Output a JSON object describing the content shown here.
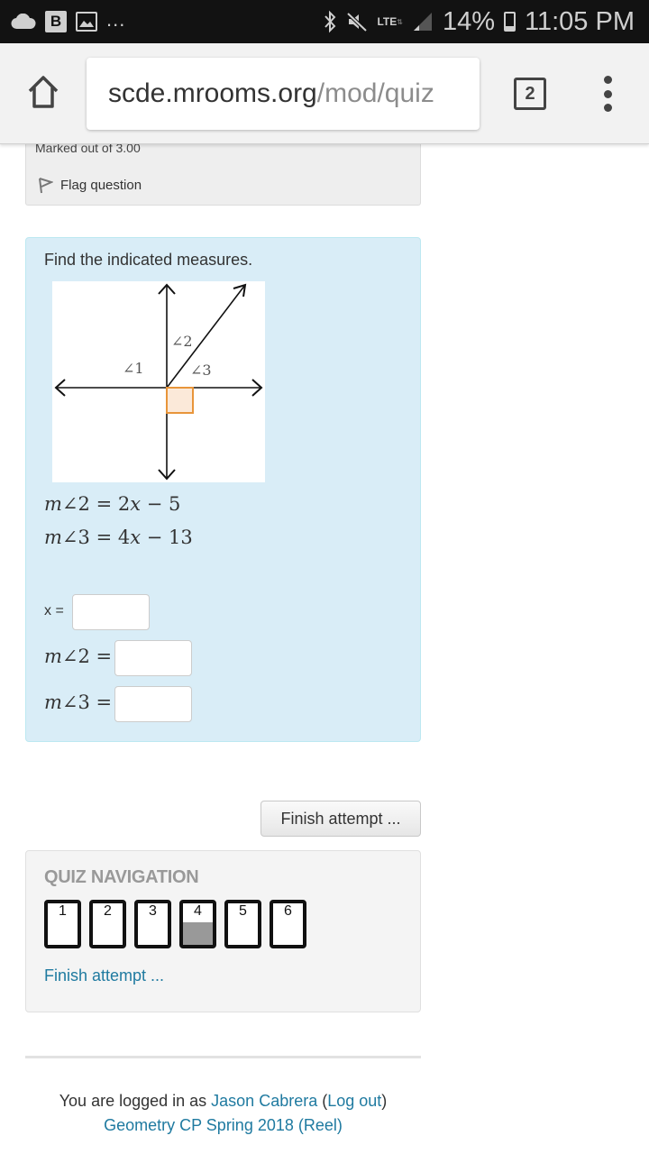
{
  "status_bar": {
    "left_icons": [
      "cloud-icon",
      "b-app-icon",
      "image-icon",
      "more-notifications-icon"
    ],
    "more_text": "...",
    "network_type": "LTE",
    "battery_percent": "14%",
    "time": "11:05 PM"
  },
  "browser": {
    "url_host": "scde.mrooms.org",
    "url_path": "/mod/quiz",
    "tab_count": "2"
  },
  "question_info": {
    "marked_out_of": "Marked out of 3.00",
    "flag_label": "Flag question"
  },
  "question": {
    "prompt": "Find the indicated measures.",
    "figure_labels": {
      "angle1": "∠1",
      "angle2": "∠2",
      "angle3": "∠3"
    },
    "equations": [
      {
        "lhs_m": "m",
        "lhs_angle": "∠2",
        "rhs": "= 2",
        "var": "x",
        "tail": " − 5"
      },
      {
        "lhs_m": "m",
        "lhs_angle": "∠3",
        "rhs": "= 4",
        "var": "x",
        "tail": " − 13"
      }
    ],
    "answers": [
      {
        "label": "x =",
        "value": ""
      },
      {
        "label_m": "m",
        "label_angle": "∠2 =",
        "value": ""
      },
      {
        "label_m": "m",
        "label_angle": "∠3 =",
        "value": ""
      }
    ]
  },
  "finish_button_label": "Finish attempt ...",
  "quiz_navigation": {
    "title": "QUIZ NAVIGATION",
    "questions": [
      {
        "number": "1",
        "answered_fraction": 0
      },
      {
        "number": "2",
        "answered_fraction": 0
      },
      {
        "number": "3",
        "answered_fraction": 0
      },
      {
        "number": "4",
        "answered_fraction": 0.55,
        "current": true
      },
      {
        "number": "5",
        "answered_fraction": 0
      },
      {
        "number": "6",
        "answered_fraction": 0
      }
    ],
    "finish_link": "Finish attempt ..."
  },
  "footer": {
    "logged_in_prefix": "You are logged in as ",
    "user_name": "Jason Cabrera",
    "logout_label": "Log out",
    "course_link": "Geometry CP Spring 2018 (Reel)"
  },
  "colors": {
    "question_bg": "#d9edf7",
    "link": "#1f7aa0",
    "right_angle_marker": "#e8953a"
  }
}
